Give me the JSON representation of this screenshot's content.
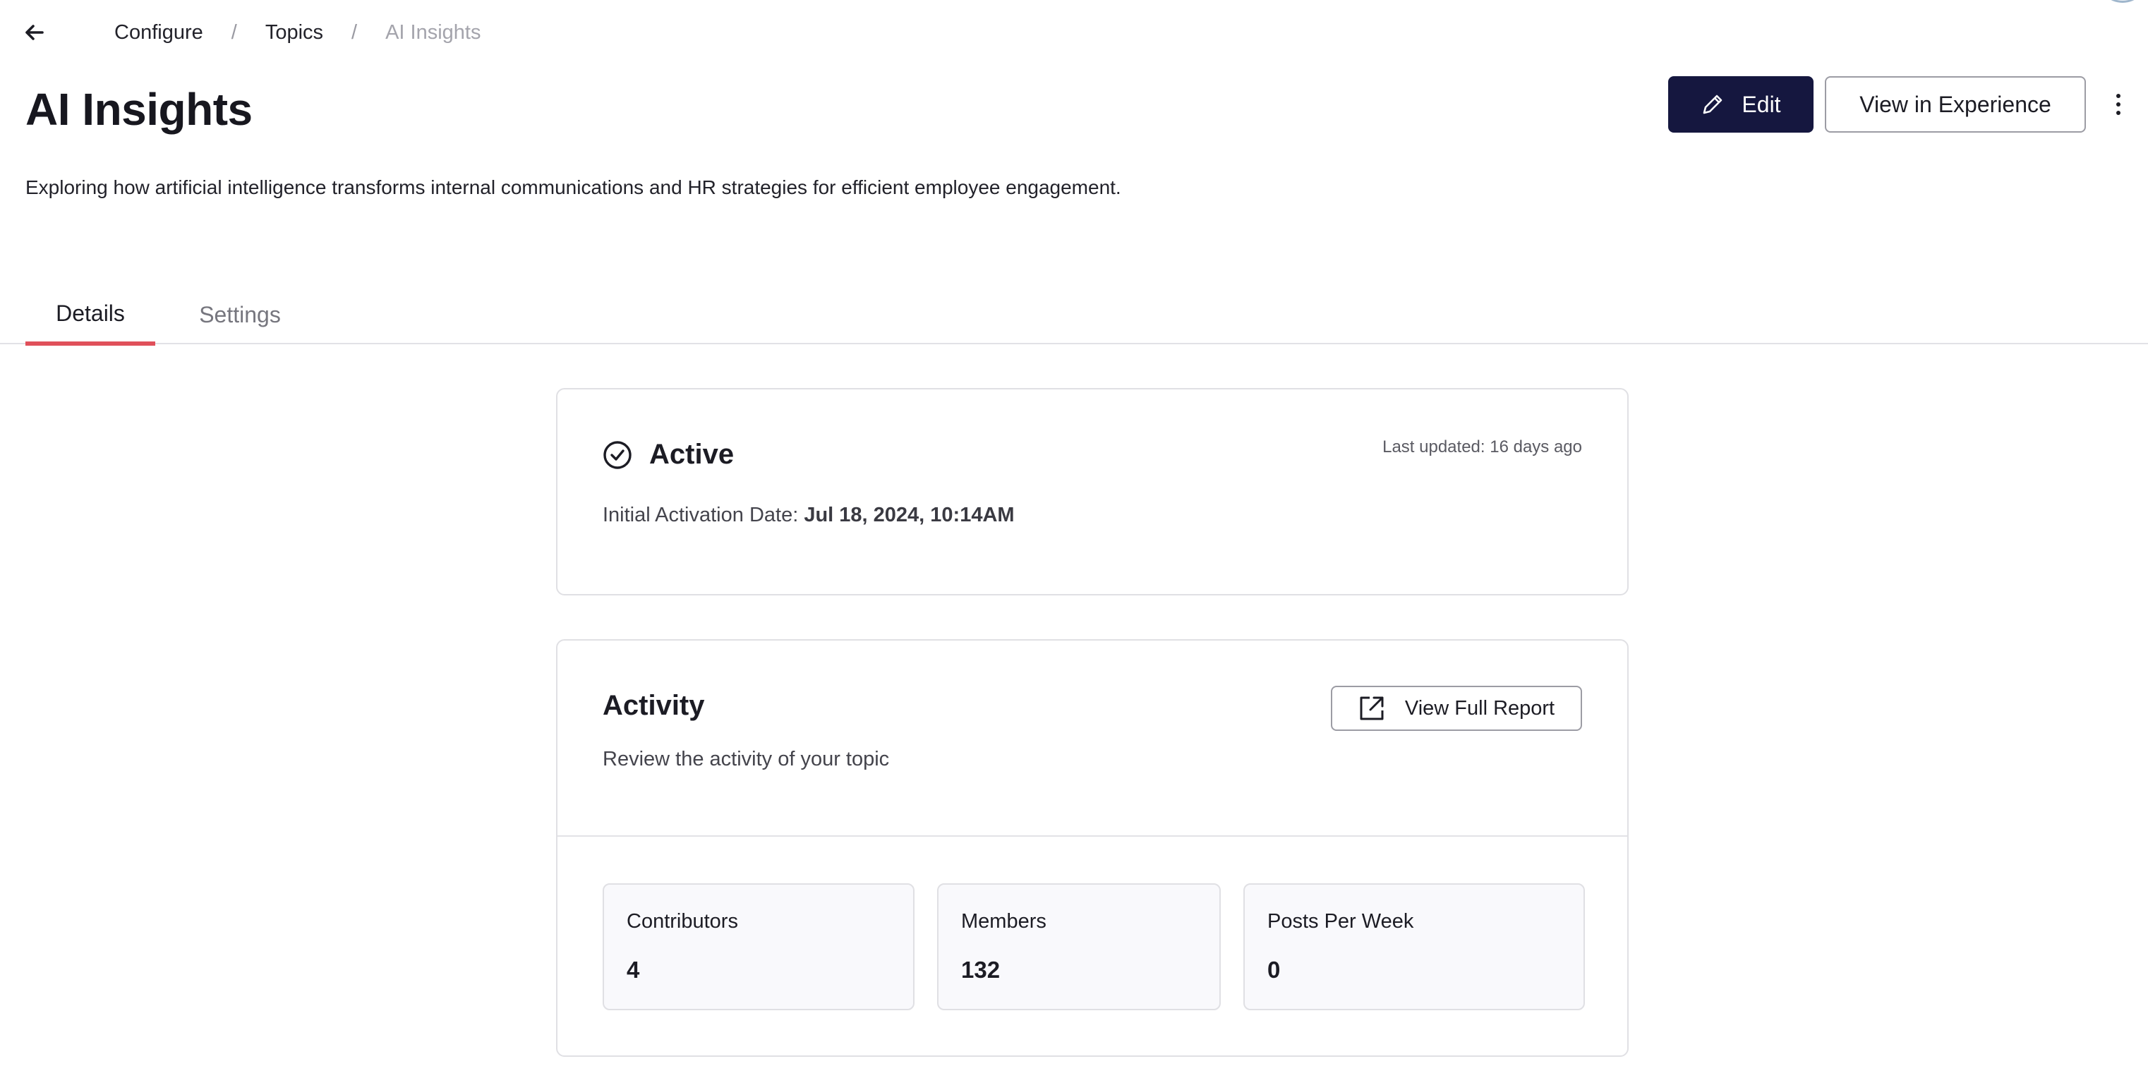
{
  "breadcrumb": {
    "items": [
      "Configure",
      "Topics",
      "AI Insights"
    ],
    "separator": "/"
  },
  "header": {
    "title": "AI Insights",
    "edit_label": "Edit",
    "view_label": "View in Experience"
  },
  "description": "Exploring how artificial intelligence transforms internal communications and HR strategies for efficient employee engagement.",
  "tabs": [
    {
      "label": "Details",
      "active": true
    },
    {
      "label": "Settings",
      "active": false
    }
  ],
  "status": {
    "title": "Active",
    "last_updated": "Last updated: 16 days ago",
    "activation_label": "Initial Activation Date: ",
    "activation_value": "Jul 18, 2024, 10:14AM"
  },
  "activity": {
    "title": "Activity",
    "subtitle": "Review the activity of your topic",
    "report_label": "View Full Report",
    "stats": [
      {
        "label": "Contributors",
        "value": "4"
      },
      {
        "label": "Members",
        "value": "132"
      },
      {
        "label": "Posts Per Week",
        "value": "0"
      }
    ]
  },
  "colors": {
    "primary_button": "#15173f",
    "tab_indicator": "#e0505a"
  },
  "icons": {
    "back": "arrow-left-icon",
    "edit": "pencil-icon",
    "more": "kebab-icon",
    "status": "check-circle-icon",
    "report": "external-link-icon"
  }
}
